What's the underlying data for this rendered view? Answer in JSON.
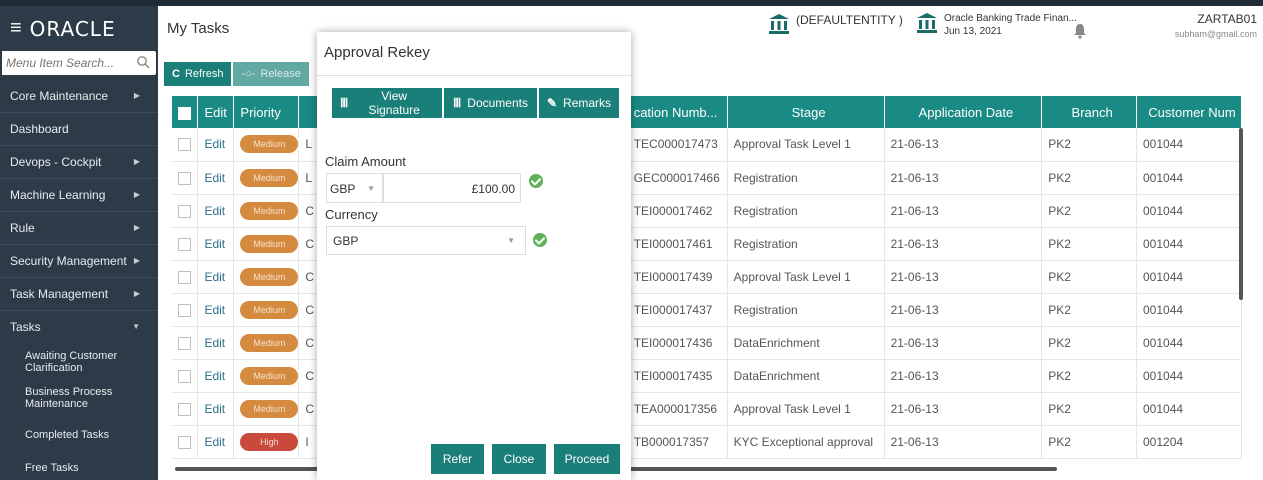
{
  "header": {
    "logo": "ORACLE",
    "page_title": "My Tasks",
    "entity": "(DEFAULTENTITY )",
    "app_name": "Oracle Banking Trade Finan...",
    "app_date": "Jun 13, 2021",
    "user_id": "ZARTAB01",
    "user_email": "subham@gmail.com"
  },
  "sidebar": {
    "search_placeholder": "Menu Item Search...",
    "items": [
      {
        "label": "Core Maintenance",
        "arrow": "▶"
      },
      {
        "label": "Dashboard",
        "arrow": ""
      },
      {
        "label": "Devops - Cockpit",
        "arrow": "▶"
      },
      {
        "label": "Machine Learning",
        "arrow": "▶"
      },
      {
        "label": "Rule",
        "arrow": "▶"
      },
      {
        "label": "Security Management",
        "arrow": "▶"
      },
      {
        "label": "Task Management",
        "arrow": "▶"
      },
      {
        "label": "Tasks",
        "arrow": "▼"
      }
    ],
    "subitems": [
      {
        "label": "Awaiting Customer Clarification"
      },
      {
        "label": "Business Process Maintenance"
      },
      {
        "label": "Completed Tasks"
      },
      {
        "label": "Free Tasks"
      }
    ]
  },
  "toolbar": {
    "refresh_label": "Refresh",
    "release_label": "Release"
  },
  "table": {
    "headers": {
      "edit": "Edit",
      "priority": "Priority",
      "app_number": "cation Numb...",
      "stage": "Stage",
      "app_date": "Application Date",
      "branch": "Branch",
      "customer": "Customer Num"
    },
    "rows": [
      {
        "edit": "Edit",
        "priority": "Medium",
        "pclass": "",
        "col3": "L",
        "app_number": "TEC000017473",
        "stage": "Approval Task Level 1",
        "date": "21-06-13",
        "branch": "PK2",
        "customer": "001044"
      },
      {
        "edit": "Edit",
        "priority": "Medium",
        "pclass": "",
        "col3": "L",
        "app_number": "GEC000017466",
        "stage": "Registration",
        "date": "21-06-13",
        "branch": "PK2",
        "customer": "001044"
      },
      {
        "edit": "Edit",
        "priority": "Medium",
        "pclass": "",
        "col3": "C",
        "app_number": "TEI000017462",
        "stage": "Registration",
        "date": "21-06-13",
        "branch": "PK2",
        "customer": "001044"
      },
      {
        "edit": "Edit",
        "priority": "Medium",
        "pclass": "",
        "col3": "C",
        "app_number": "TEI000017461",
        "stage": "Registration",
        "date": "21-06-13",
        "branch": "PK2",
        "customer": "001044"
      },
      {
        "edit": "Edit",
        "priority": "Medium",
        "pclass": "",
        "col3": "C",
        "app_number": "TEI000017439",
        "stage": "Approval Task Level 1",
        "date": "21-06-13",
        "branch": "PK2",
        "customer": "001044"
      },
      {
        "edit": "Edit",
        "priority": "Medium",
        "pclass": "",
        "col3": "C",
        "app_number": "TEI000017437",
        "stage": "Registration",
        "date": "21-06-13",
        "branch": "PK2",
        "customer": "001044"
      },
      {
        "edit": "Edit",
        "priority": "Medium",
        "pclass": "",
        "col3": "C",
        "app_number": "TEI000017436",
        "stage": "DataEnrichment",
        "date": "21-06-13",
        "branch": "PK2",
        "customer": "001044"
      },
      {
        "edit": "Edit",
        "priority": "Medium",
        "pclass": "",
        "col3": "C",
        "app_number": "TEI000017435",
        "stage": "DataEnrichment",
        "date": "21-06-13",
        "branch": "PK2",
        "customer": "001044"
      },
      {
        "edit": "Edit",
        "priority": "Medium",
        "pclass": "",
        "col3": "C",
        "app_number": "TEA000017356",
        "stage": "Approval Task Level 1",
        "date": "21-06-13",
        "branch": "PK2",
        "customer": "001044"
      },
      {
        "edit": "Edit",
        "priority": "High",
        "pclass": "high",
        "col3": "I",
        "app_number": "TB000017357",
        "stage": "KYC Exceptional approval",
        "date": "21-06-13",
        "branch": "PK2",
        "customer": "001204"
      }
    ]
  },
  "modal": {
    "title": "Approval Rekey",
    "view_signature": "View Signature",
    "documents": "Documents",
    "remarks": "Remarks",
    "claim_amount_label": "Claim Amount",
    "claim_ccy": "GBP",
    "claim_amount": "£100.00",
    "currency_label": "Currency",
    "currency_value": "GBP",
    "refer": "Refer",
    "close": "Close",
    "proceed": "Proceed"
  },
  "colors": {
    "brand_dark": "#2c3b47",
    "accent_teal": "#1a7f79",
    "medium_priority": "#d48a3f",
    "high_priority": "#c94a3c",
    "ok_green": "#5fb15a"
  }
}
